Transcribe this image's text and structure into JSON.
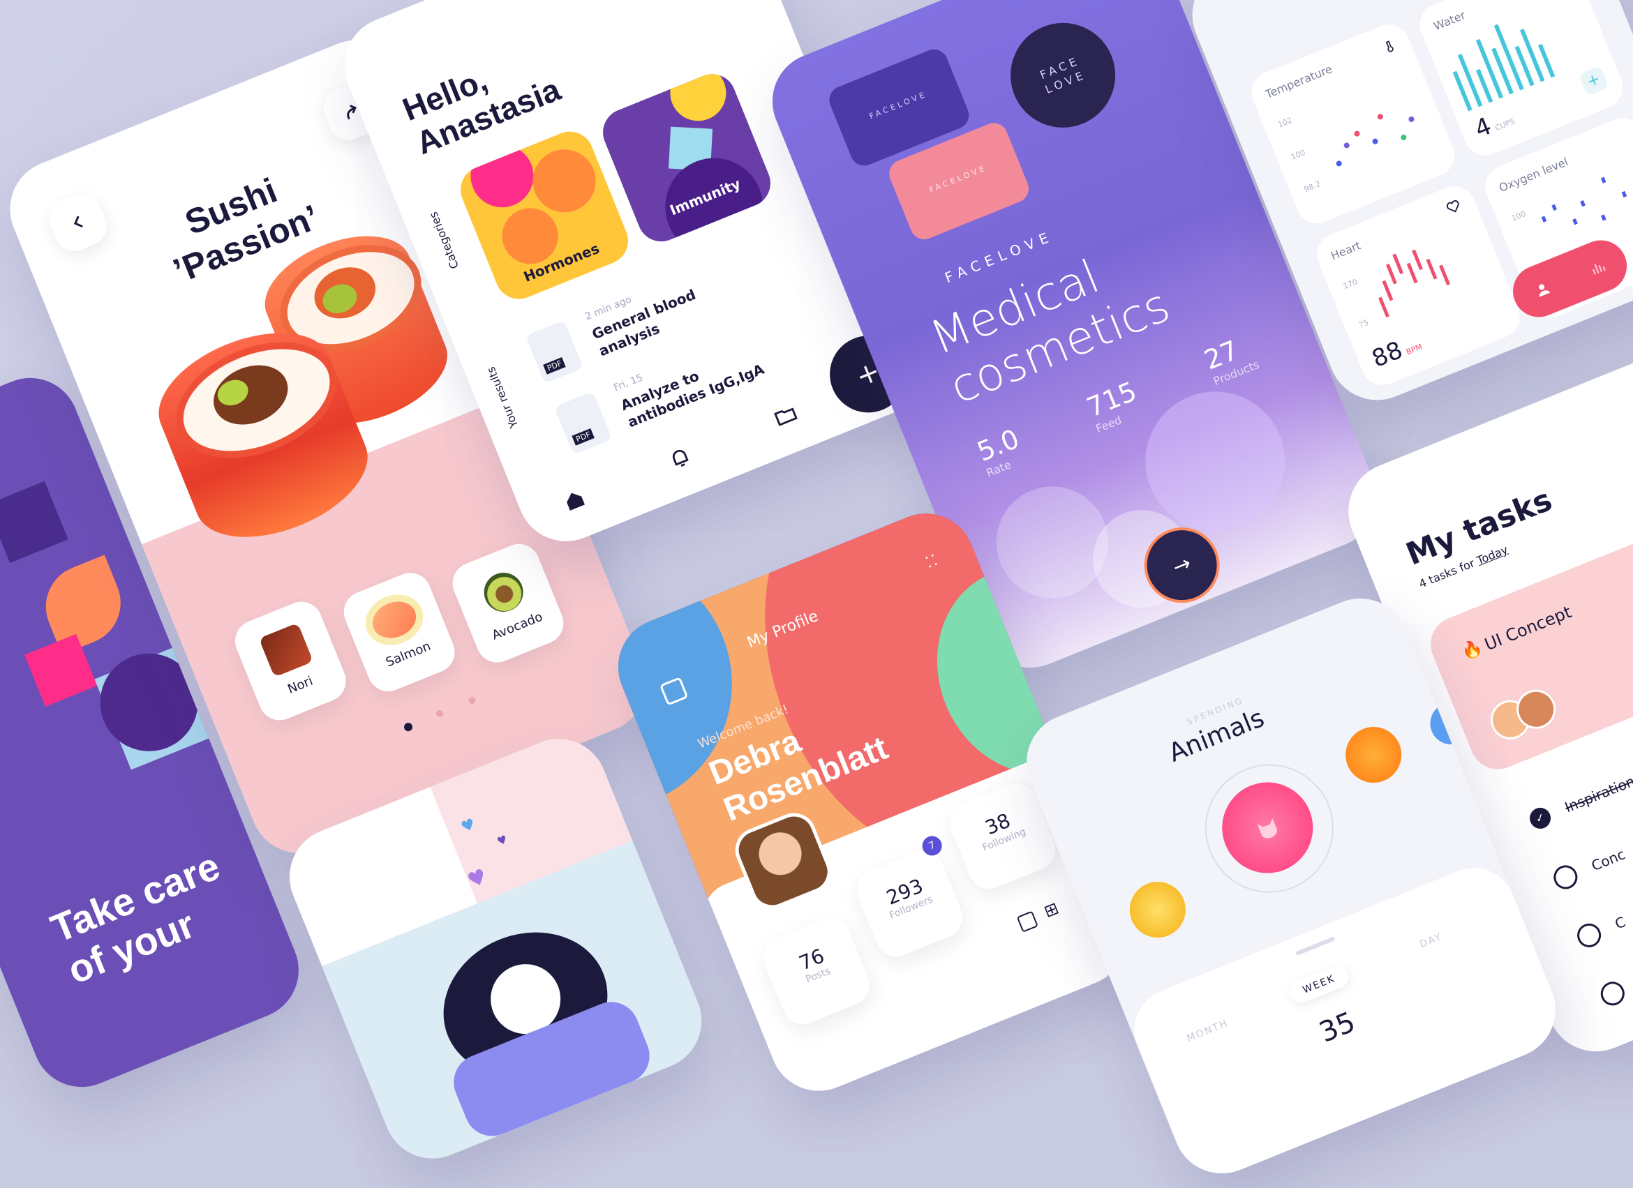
{
  "sushi": {
    "title_line1": "Sushi",
    "title_line2": "’Passion’",
    "ingredients": [
      "Nori",
      "Salmon",
      "Avocado"
    ]
  },
  "health": {
    "greeting_line1": "Hello,",
    "greeting_line2": "Anastasia",
    "categories_label": "Categories",
    "categories": [
      "Hormones",
      "Immunity"
    ],
    "results_label": "Your results",
    "results": [
      {
        "time": "2 min ago",
        "title_line1": "General blood",
        "title_line2": "analysis",
        "file": "PDF"
      },
      {
        "time": "Fri, 15",
        "title_line1": "Analyze to",
        "title_line2": "antibodies IgG,IgA",
        "file": "PDF"
      }
    ],
    "fab": "+"
  },
  "cosmetics": {
    "jar_brand": "FACELOVE",
    "lid_line1": "FACE",
    "lid_line2": "LOVE",
    "brand": "FACELOVE",
    "title_line1": "Medical",
    "title_line2": "cosmetics",
    "stats": [
      {
        "value": "5.0",
        "label": "Rate"
      },
      {
        "value": "715",
        "label": "Feed"
      },
      {
        "value": "27",
        "label": "Products"
      }
    ],
    "arrow": "→"
  },
  "vitals": {
    "temperature": {
      "label": "Temperature",
      "ticks": [
        "102",
        "100",
        "98.2"
      ]
    },
    "water": {
      "label": "Water",
      "value": "4",
      "unit": "CUPS",
      "add": "+"
    },
    "heart": {
      "label": "Heart",
      "ticks": [
        "170",
        "75"
      ],
      "value": "88",
      "unit": "BPM"
    },
    "oxygen": {
      "label": "Oxygen level",
      "ticks": [
        "100"
      ]
    }
  },
  "tasks": {
    "title": "My tasks",
    "subtitle_prefix": "4 tasks for",
    "subtitle_link": "Today",
    "concept_label": "UI Concept",
    "items": [
      "Inspiration",
      "Conc",
      "C",
      ""
    ]
  },
  "profile": {
    "header": "My Profile",
    "welcome": "Welcome back!",
    "name_line1": "Debra",
    "name_line2": "Rosenblatt",
    "badge": "7",
    "stats": [
      {
        "value": "76",
        "label": "Posts"
      },
      {
        "value": "293",
        "label": "Followers"
      },
      {
        "value": "38",
        "label": "Following"
      }
    ]
  },
  "spending": {
    "overline": "SPENDING",
    "title": "Animals",
    "periods": [
      "MONTH",
      "WEEK",
      "DAY"
    ],
    "amount": "35"
  },
  "care": {
    "line1": "Take care",
    "line2": "of your"
  }
}
